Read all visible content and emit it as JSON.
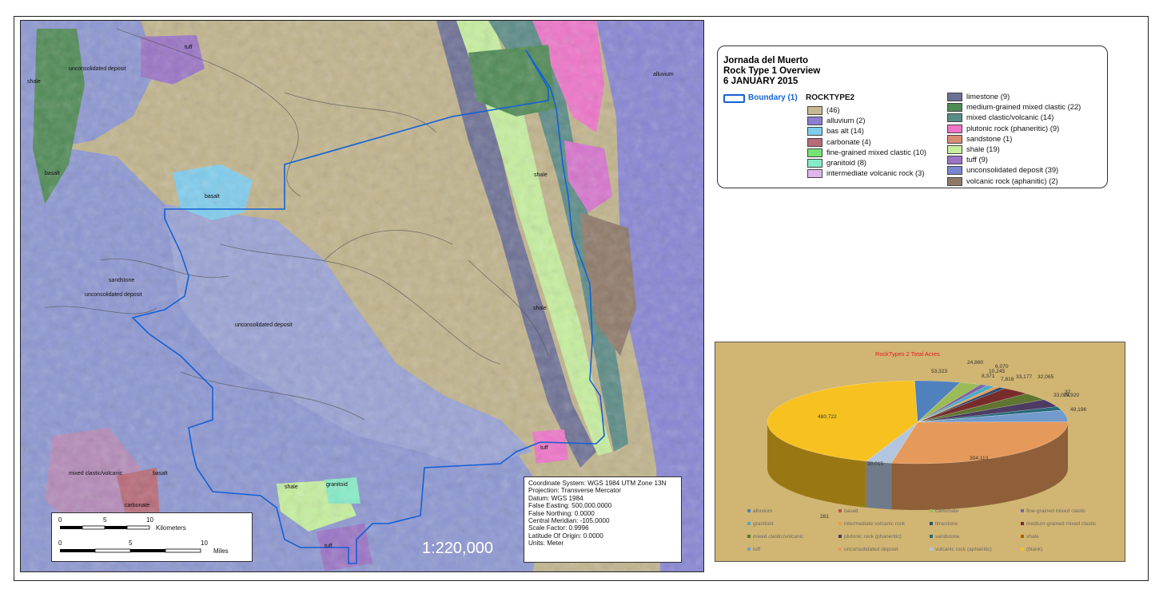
{
  "map": {
    "labels": {
      "tuff": "tuff",
      "unconsolidated1": "unconsolidated deposit",
      "shale1": "shale",
      "alluvium": "alluvium",
      "basalt1": "basalt",
      "basalt2": "basalt",
      "unconsolidated2": "unconsolidated deposit",
      "unconsolidated3": "unconsolidated deposit",
      "sandstone": "sandstone",
      "shale2": "shale",
      "shale3": "shale",
      "mixed": "mixed clastic/volcanic",
      "basalt3": "basalt",
      "carbonate": "carbonate",
      "shale4": "shale",
      "granitoid": "granitoid",
      "tuff2": "tuff",
      "tuff3": "tuff"
    },
    "scale_text": "1:220,000"
  },
  "info": {
    "lines": [
      "Coordinate System: WGS 1984 UTM Zone 13N",
      "Projection: Transverse Mercator",
      "Datum: WGS 1984",
      "False Easting: 500,000.0000",
      "False Northing: 0.0000",
      "Central Meridian: -105.0000",
      "Scale Factor: 0.9996",
      "Latitude Of Origin: 0.0000",
      "Units: Meter"
    ]
  },
  "scalebar": {
    "km_ticks": [
      "0",
      "5",
      "10"
    ],
    "km_unit": "Kilometers",
    "mi_ticks": [
      "0",
      "5",
      "10"
    ],
    "mi_unit": "Miles"
  },
  "legend": {
    "title_lines": [
      "Jornada del Muerto",
      "Rock Type 1  Overview",
      "6 JANUARY 2015"
    ],
    "boundary": "Boundary (1)",
    "field": "ROCKTYPE2",
    "items_left": [
      {
        "label": " (46)",
        "color": "#c5b98f"
      },
      {
        "label": "alluvium (2)",
        "color": "#8a7fd1"
      },
      {
        "label": "bas alt (14)",
        "color": "#7fcdee"
      },
      {
        "label": "carbonate (4)",
        "color": "#b86a78"
      },
      {
        "label": "fine-grained mixed clastic (10)",
        "color": "#74e374"
      },
      {
        "label": "granitoid (8)",
        "color": "#86ecc8"
      },
      {
        "label": "intermediate volcanic rock (3)",
        "color": "#e0b6ec"
      }
    ],
    "items_right": [
      {
        "label": "limestone (9)",
        "color": "#6d7095"
      },
      {
        "label": "medium-grained mixed clastic (22)",
        "color": "#4f8a55"
      },
      {
        "label": "mixed clastic/volcanic (14)",
        "color": "#5b8b86"
      },
      {
        "label": "plutonic rock (phaneritic) (9)",
        "color": "#ef74c9"
      },
      {
        "label": "sandstone (1)",
        "color": "#d88c74"
      },
      {
        "label": "shale (19)",
        "color": "#c6ef9e"
      },
      {
        "label": "tuff (9)",
        "color": "#9a74c6"
      },
      {
        "label": "unconsolidated deposit (39)",
        "color": "#7a86d2"
      },
      {
        "label": "volcanic rock (aphanitic) (2)",
        "color": "#8e7968"
      }
    ]
  },
  "chart_data": {
    "type": "pie",
    "title": "RockTypes 2 Total Acres",
    "title_color": "#e02020",
    "slices": [
      {
        "name": "alluvium",
        "value": 53323,
        "label": "53,323",
        "color": "#4f81bd"
      },
      {
        "name": "basalt",
        "value": 281,
        "label": "281",
        "color": "#c0504d"
      },
      {
        "name": "carbonate",
        "value": 24880,
        "label": "24,880",
        "color": "#9bbb59"
      },
      {
        "name": "fine-grained mixed clastic",
        "value": 8371,
        "label": "8,371",
        "color": "#8064a2"
      },
      {
        "name": "granitoid",
        "value": 10245,
        "label": "10,245",
        "color": "#4bacc6"
      },
      {
        "name": "intermediate volcanic rock",
        "value": 6070,
        "label": "6,070",
        "color": "#f79646"
      },
      {
        "name": "limestone",
        "value": 7816,
        "label": "7,816",
        "color": "#2c4d75"
      },
      {
        "name": "medium-grained mixed clastic",
        "value": 33177,
        "label": "33,177",
        "color": "#772c2a"
      },
      {
        "name": "mixed clastic/volcanic",
        "value": 32065,
        "label": "32,065",
        "color": "#5f7530"
      },
      {
        "name": "plutonic rock (phaneritic)",
        "value": 33074,
        "label": "33,074",
        "color": "#4d3b62"
      },
      {
        "name": "sandstone",
        "value": 15920,
        "label": "15,920",
        "color": "#276a7c"
      },
      {
        "name": "shale",
        "value": 32,
        "label": "32",
        "color": "#b65708"
      },
      {
        "name": "tuff",
        "value": 49196,
        "label": "49,196",
        "color": "#729aca"
      },
      {
        "name": "unconsolidated deposit",
        "value": 304113,
        "label": "304,113",
        "color": "#e59a5c"
      },
      {
        "name": "volcanic rock (aphanitic)",
        "value": 30015,
        "label": "30,015",
        "color": "#b3c6e0"
      },
      {
        "name": "(blank)",
        "value": 480722,
        "label": "480,722",
        "color": "#f7c21f"
      }
    ],
    "legend_items": [
      "alluvium",
      "basalt",
      "carbonate",
      "fine-grained mixed clastic",
      "granitoid",
      "intermediate volcanic rock",
      "limestone",
      "medium-grained mixed clastic",
      "mixed clastic/volcanic",
      "plutonic rock (phaneritic)",
      "sandstone",
      "shale",
      "tuff",
      "unconsolidated deposit",
      "volcanic rock (aphanitic)",
      "(blank)"
    ]
  }
}
